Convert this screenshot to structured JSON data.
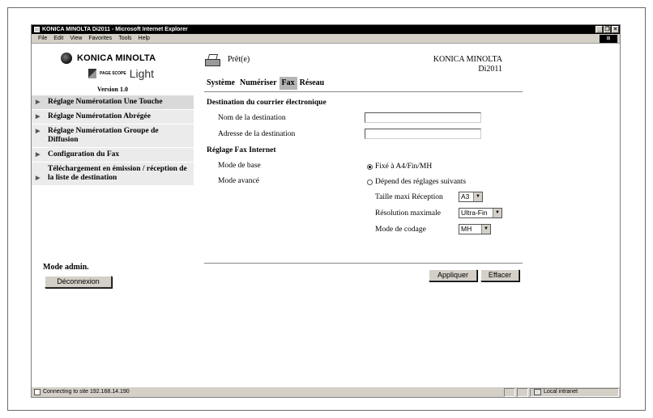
{
  "window": {
    "title": "KONICA MINOLTA Di2011 - Microsoft Internet Explorer",
    "controls": [
      "_",
      "❐",
      "×"
    ]
  },
  "menubar": {
    "items": [
      "File",
      "Edit",
      "View",
      "Favorites",
      "Tools",
      "Help"
    ]
  },
  "sidebar": {
    "brand_name": "KONICA MINOLTA",
    "pagescope_small": "PAGE SCOPE",
    "pagescope_light": "Light",
    "version": "Version 1.0",
    "nav_items": [
      {
        "label": "Réglage Numérotation Une Touche",
        "active": true
      },
      {
        "label": "Réglage Numérotation Abrégée",
        "active": false
      },
      {
        "label": "Réglage Numérotation Groupe de Diffusion",
        "active": false
      },
      {
        "label": "Configuration du Fax",
        "active": false
      },
      {
        "label": "Téléchargement en émission / réception de la liste de destination",
        "active": false
      }
    ],
    "admin_label": "Mode admin.",
    "logout_label": "Déconnexion"
  },
  "header": {
    "status": "Prêt(e)",
    "brand_line1": "KONICA MINOLTA",
    "brand_line2": "Di2011"
  },
  "tabs": [
    {
      "label": "Système",
      "active": false
    },
    {
      "label": "Numériser",
      "active": false
    },
    {
      "label": "Fax",
      "active": true
    },
    {
      "label": "Réseau",
      "active": false
    }
  ],
  "form": {
    "section_email": "Destination du courrier électronique",
    "dest_name_label": "Nom de la destination",
    "dest_name_value": "",
    "dest_address_label": "Adresse de la destination",
    "dest_address_value": "",
    "section_ifax": "Réglage Fax Internet",
    "basic_mode_label": "Mode de base",
    "basic_mode_option": "Fixé à A4/Fin/MH",
    "advanced_mode_label": "Mode avancé",
    "advanced_mode_option": "Dépend des réglages suivants",
    "rx_size_label": "Taille maxi Réception",
    "rx_size_value": "A3",
    "resolution_label": "Résolution maximale",
    "resolution_value": "Ultra-Fin",
    "coding_label": "Mode de codage",
    "coding_value": "MH",
    "selected_mode": "basic",
    "apply_label": "Appliquer",
    "clear_label": "Effacer"
  },
  "statusbar": {
    "text": "Connecting to site 192.168.14.190",
    "zone": "Local intranet"
  }
}
